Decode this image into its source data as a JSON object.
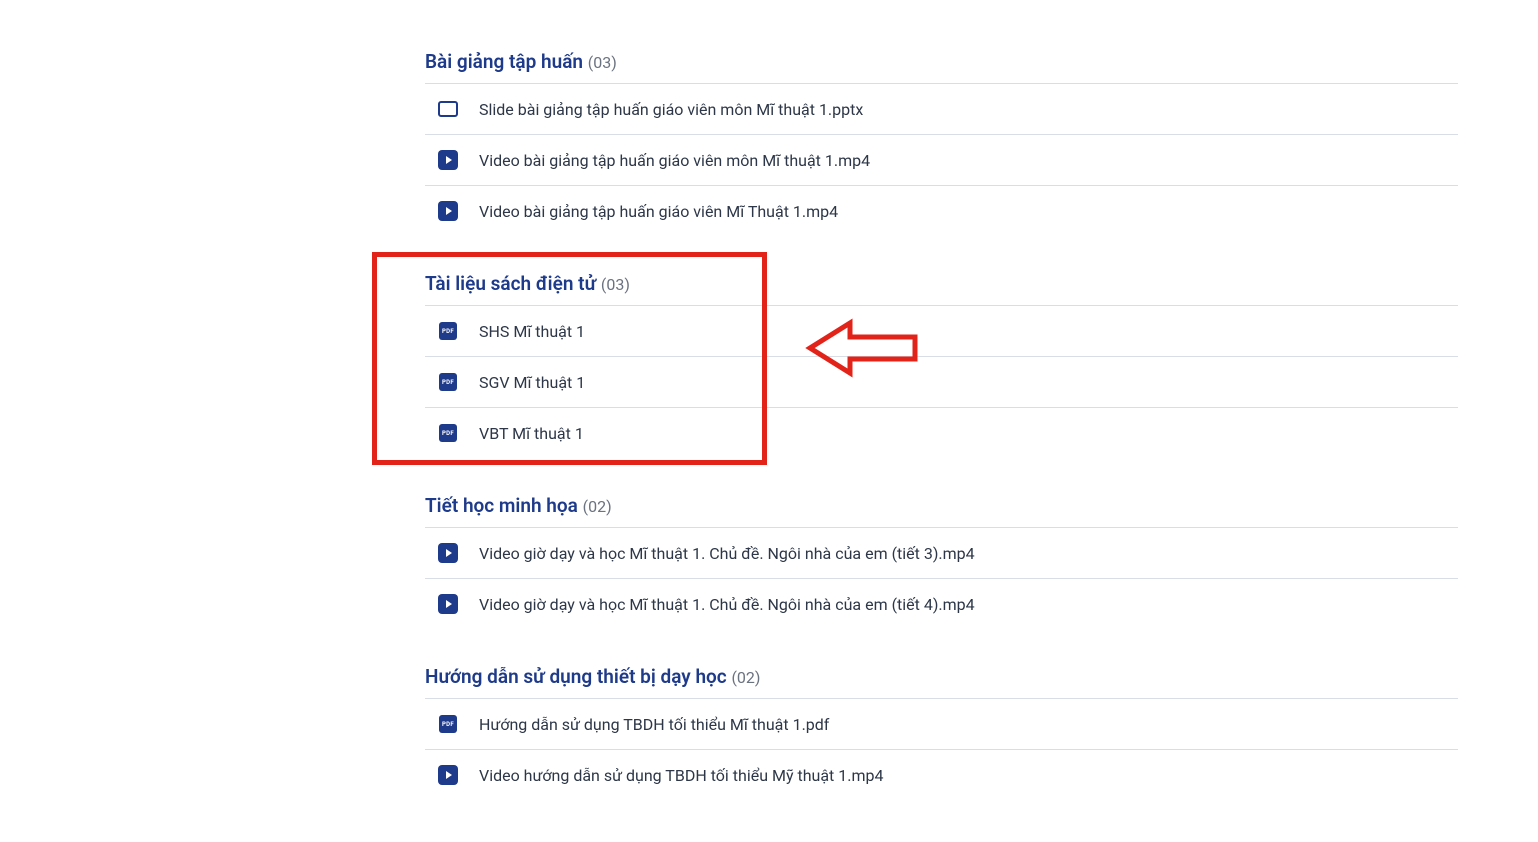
{
  "sections": [
    {
      "title": "Bài giảng tập huấn",
      "count": "(03)",
      "items": [
        {
          "icon": "slide",
          "label": "Slide bài giảng tập huấn giáo viên môn Mĩ thuật 1.pptx"
        },
        {
          "icon": "video",
          "label": "Video bài giảng tập huấn giáo viên môn Mĩ thuật 1.mp4"
        },
        {
          "icon": "video",
          "label": "Video bài giảng tập huấn giáo viên Mĩ Thuật 1.mp4"
        }
      ]
    },
    {
      "title": "Tài liệu sách điện tử",
      "count": "(03)",
      "items": [
        {
          "icon": "pdf",
          "label": "SHS Mĩ thuật 1"
        },
        {
          "icon": "pdf",
          "label": "SGV Mĩ thuật 1"
        },
        {
          "icon": "pdf",
          "label": "VBT Mĩ thuật 1"
        }
      ]
    },
    {
      "title": "Tiết học minh họa",
      "count": "(02)",
      "items": [
        {
          "icon": "video",
          "label": "Video giờ dạy và học Mĩ thuật 1. Chủ đề. Ngôi nhà của em (tiết 3).mp4"
        },
        {
          "icon": "video",
          "label": "Video giờ dạy và học Mĩ thuật 1. Chủ đề. Ngôi nhà của em (tiết 4).mp4"
        }
      ]
    },
    {
      "title": "Hướng dẫn sử dụng thiết bị dạy học",
      "count": "(02)",
      "items": [
        {
          "icon": "pdf",
          "label": "Hướng dẫn sử dụng TBDH tối thiểu Mĩ thuật 1.pdf"
        },
        {
          "icon": "video",
          "label": "Video hướng dẫn sử dụng TBDH tối thiểu Mỹ thuật 1.mp4"
        }
      ]
    }
  ],
  "annotations": {
    "pdf_badge": "PDF"
  }
}
